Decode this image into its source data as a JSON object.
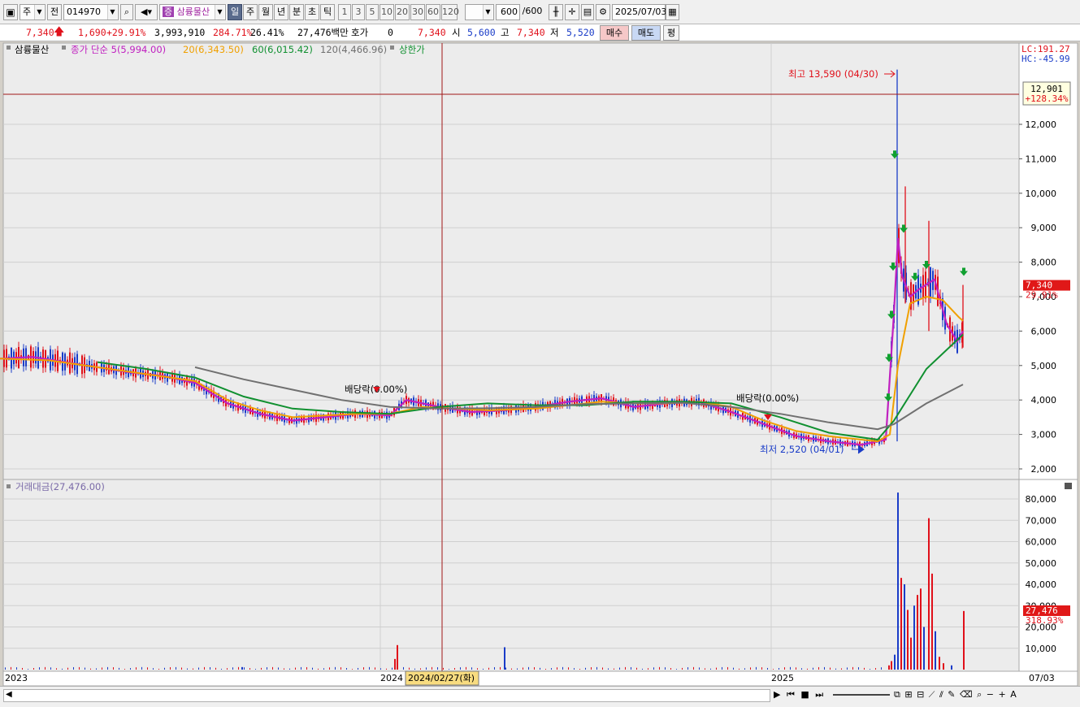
{
  "toolbar": {
    "market": "주",
    "prev": "전",
    "code": "014970",
    "stock_tag": "증",
    "stock_name": "삼륭물산",
    "periods": [
      "일",
      "주",
      "월",
      "년",
      "분",
      "초",
      "틱"
    ],
    "active_period": "일",
    "intervals": [
      "1",
      "3",
      "5",
      "10",
      "20",
      "30",
      "60",
      "120"
    ],
    "count_value": "600",
    "count_total": "/600",
    "date": "2025/07/03"
  },
  "quote": {
    "price": "7,340",
    "change": "1,690",
    "change_pct": "+29.91%",
    "volume": "3,993,910",
    "volume_ratio": "284.71%",
    "turnover": "26.41%",
    "amount": "27,476백만",
    "hoga_label": "호가",
    "hoga_value": "0",
    "hoga_price": "7,340",
    "open_label": "시",
    "open_value": "5,600",
    "high_label": "고",
    "high_value": "7,340",
    "low_label": "저",
    "low_value": "5,520",
    "buy_label": "매수",
    "sell_label": "매도",
    "eval_label": "평"
  },
  "chart_data": {
    "type": "line",
    "title": "삼륭물산",
    "legend": [
      {
        "label": "삼륭물산",
        "color": "#000000"
      },
      {
        "label": "종가 단순 5(5,994.00)",
        "color": "#c020c0"
      },
      {
        "label": "20(6,343.50)",
        "color": "#f0a000"
      },
      {
        "label": "60(6,015.42)",
        "color": "#109030"
      },
      {
        "label": "120(4,466.96)",
        "color": "#707070"
      },
      {
        "label": "상한가",
        "color": "#109030"
      }
    ],
    "x_labels": [
      "2023",
      "2024",
      "2024/02/27(화)",
      "2025",
      "07/03"
    ],
    "price_axis": {
      "ticks": [
        "12,000",
        "11,000",
        "10,000",
        "9,000",
        "8,000",
        "7,000",
        "6,000",
        "5,000",
        "4,000",
        "3,000",
        "2,000"
      ],
      "lc": "LC:191.27",
      "hc": "HC:-45.99",
      "cursor_value": "12,901",
      "cursor_pct": "+128.34%",
      "last_price": "7,340",
      "last_pct": "29.91%"
    },
    "annotations": {
      "high": "최고 13,590 (04/30)",
      "low": "최저 2,520 (04/01)",
      "dividend_1": "배당락(0.00%)",
      "dividend_2": "배당락(0.00%)"
    },
    "series": [
      {
        "name": "5",
        "color": "#c020c0",
        "points": [
          [
            0,
            5200
          ],
          [
            40,
            5250
          ],
          [
            80,
            5100
          ],
          [
            120,
            4950
          ],
          [
            160,
            4800
          ],
          [
            200,
            4700
          ],
          [
            240,
            4500
          ],
          [
            280,
            3900
          ],
          [
            320,
            3600
          ],
          [
            360,
            3400
          ],
          [
            400,
            3500
          ],
          [
            440,
            3600
          ],
          [
            480,
            3550
          ],
          [
            500,
            4000
          ],
          [
            540,
            3800
          ],
          [
            580,
            3650
          ],
          [
            620,
            3700
          ],
          [
            660,
            3800
          ],
          [
            700,
            3950
          ],
          [
            740,
            4050
          ],
          [
            780,
            3800
          ],
          [
            820,
            3900
          ],
          [
            860,
            3950
          ],
          [
            900,
            3650
          ],
          [
            940,
            3300
          ],
          [
            980,
            2950
          ],
          [
            1020,
            2800
          ],
          [
            1060,
            2700
          ],
          [
            1090,
            2850
          ],
          [
            1100,
            6500
          ],
          [
            1105,
            8700
          ],
          [
            1110,
            7600
          ],
          [
            1120,
            7000
          ],
          [
            1130,
            7200
          ],
          [
            1150,
            7500
          ],
          [
            1165,
            6200
          ],
          [
            1178,
            5700
          ],
          [
            1185,
            6000
          ]
        ]
      },
      {
        "name": "20",
        "color": "#f0a000",
        "points": [
          [
            0,
            5200
          ],
          [
            60,
            5150
          ],
          [
            120,
            4950
          ],
          [
            180,
            4750
          ],
          [
            240,
            4550
          ],
          [
            280,
            4000
          ],
          [
            320,
            3700
          ],
          [
            360,
            3500
          ],
          [
            400,
            3550
          ],
          [
            440,
            3600
          ],
          [
            480,
            3600
          ],
          [
            520,
            3800
          ],
          [
            560,
            3750
          ],
          [
            600,
            3700
          ],
          [
            660,
            3750
          ],
          [
            700,
            3850
          ],
          [
            740,
            3950
          ],
          [
            780,
            3900
          ],
          [
            820,
            3900
          ],
          [
            860,
            3950
          ],
          [
            900,
            3800
          ],
          [
            940,
            3400
          ],
          [
            980,
            3100
          ],
          [
            1020,
            2950
          ],
          [
            1080,
            2800
          ],
          [
            1095,
            3000
          ],
          [
            1105,
            5000
          ],
          [
            1120,
            6800
          ],
          [
            1140,
            7000
          ],
          [
            1160,
            6900
          ],
          [
            1180,
            6400
          ],
          [
            1185,
            6300
          ]
        ]
      },
      {
        "name": "60",
        "color": "#109030",
        "points": [
          [
            120,
            5100
          ],
          [
            180,
            4900
          ],
          [
            240,
            4650
          ],
          [
            300,
            4100
          ],
          [
            360,
            3750
          ],
          [
            420,
            3650
          ],
          [
            480,
            3600
          ],
          [
            540,
            3800
          ],
          [
            600,
            3900
          ],
          [
            660,
            3850
          ],
          [
            720,
            3850
          ],
          [
            780,
            3950
          ],
          [
            840,
            3950
          ],
          [
            900,
            3900
          ],
          [
            960,
            3500
          ],
          [
            1020,
            3050
          ],
          [
            1080,
            2850
          ],
          [
            1100,
            3400
          ],
          [
            1140,
            4900
          ],
          [
            1185,
            5900
          ]
        ]
      },
      {
        "name": "120",
        "color": "#707070",
        "points": [
          [
            240,
            4950
          ],
          [
            300,
            4600
          ],
          [
            360,
            4300
          ],
          [
            420,
            4000
          ],
          [
            480,
            3800
          ],
          [
            540,
            3750
          ],
          [
            600,
            3760
          ],
          [
            660,
            3800
          ],
          [
            720,
            3880
          ],
          [
            780,
            3900
          ],
          [
            840,
            3920
          ],
          [
            900,
            3800
          ],
          [
            960,
            3600
          ],
          [
            1020,
            3350
          ],
          [
            1080,
            3150
          ],
          [
            1100,
            3300
          ],
          [
            1140,
            3900
          ],
          [
            1185,
            4450
          ]
        ]
      }
    ],
    "volume_axis": {
      "title": "거래대금(27,476.00)",
      "ticks": [
        "80,000",
        "70,000",
        "60,000",
        "50,000",
        "40,000",
        "30,000",
        "20,000",
        "10,000"
      ],
      "last_value": "27,476",
      "last_pct": "318.93%"
    },
    "volume_bars": [
      [
        297,
        1200
      ],
      [
        485,
        5000
      ],
      [
        488,
        11500
      ],
      [
        620,
        10500
      ],
      [
        1093,
        2000
      ],
      [
        1096,
        4000
      ],
      [
        1100,
        7000
      ],
      [
        1104,
        83000
      ],
      [
        1108,
        43000
      ],
      [
        1112,
        40000
      ],
      [
        1116,
        28000
      ],
      [
        1120,
        15000
      ],
      [
        1124,
        30000
      ],
      [
        1128,
        35000
      ],
      [
        1132,
        38000
      ],
      [
        1136,
        20000
      ],
      [
        1142,
        71000
      ],
      [
        1146,
        45000
      ],
      [
        1150,
        18000
      ],
      [
        1155,
        6000
      ],
      [
        1160,
        3000
      ],
      [
        1170,
        2000
      ],
      [
        1185,
        27476
      ]
    ]
  },
  "colors": {
    "chart_bg": "#ececec",
    "up": "#e0101a",
    "down": "#1a3cc8",
    "grid": "#cfcfcf"
  }
}
